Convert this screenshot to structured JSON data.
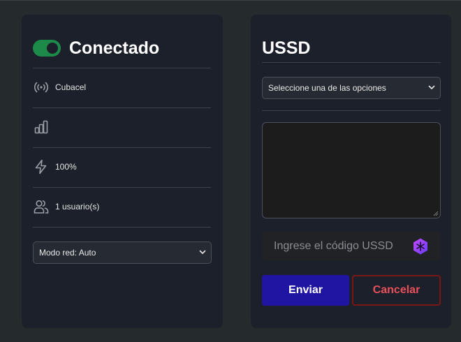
{
  "connection": {
    "status_text": "Conectado",
    "toggle_on": true,
    "toggle_color": "#1e8a4a"
  },
  "info": {
    "operator": "Cubacel",
    "signal_label": "",
    "battery": "100%",
    "users": "1 usuario(s)"
  },
  "network_mode": {
    "selected": "Modo red: Auto"
  },
  "ussd": {
    "title": "USSD",
    "select_placeholder": "Seleccione una de las opciones",
    "response": "",
    "input_placeholder": "Ingrese el código USSD",
    "send_label": "Enviar",
    "cancel_label": "Cancelar"
  },
  "colors": {
    "background": "#252a2d",
    "card": "#1b202a",
    "send_button": "#2015a3",
    "cancel_border": "#7a1616",
    "cancel_text": "#e8505b"
  }
}
